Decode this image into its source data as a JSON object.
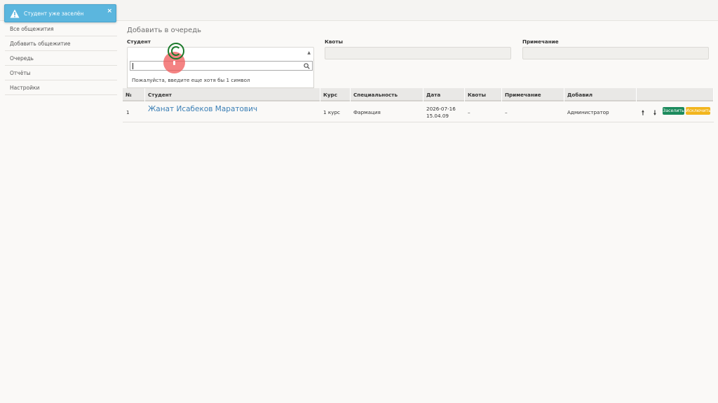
{
  "toast": {
    "message": "Студент уже заселён",
    "close": "×",
    "icon": "warning-icon"
  },
  "sidebar": {
    "items": [
      {
        "label": "Все общежития"
      },
      {
        "label": "Добавить общежитие"
      },
      {
        "label": "Очередь"
      },
      {
        "label": "Отчёты"
      },
      {
        "label": "Настройки"
      }
    ]
  },
  "form": {
    "title": "Добавить в очередь",
    "student_label": "Студент",
    "quota_label": "Квоты",
    "note_label": "Примечание",
    "student_value": "",
    "quota_value": "",
    "note_value": "",
    "dropdown": {
      "search_value": "",
      "hint": "Пожалуйста, введите еще хотя бы 1 символ"
    }
  },
  "table": {
    "headers": [
      "№",
      "Студент",
      "Курс",
      "Специальность",
      "Дата",
      "Квоты",
      "Примечание",
      "Добавил"
    ],
    "rows": [
      {
        "num": "1",
        "student": "Жанат Исабеков Маратович",
        "course": "1 курс",
        "specialty": "Фармация",
        "date": "2026-07-16",
        "time": "15.04.09",
        "quota": "–",
        "note": "–",
        "added_by": "Администратор",
        "up": "🠕",
        "down": "🠗",
        "settle_label": "Заселить",
        "exclude_label": "Исключить"
      }
    ]
  },
  "colors": {
    "toast": "#5bb6de",
    "link": "#3b7fb5",
    "settle": "#1c8a5c",
    "exclude": "#f2b51d"
  }
}
